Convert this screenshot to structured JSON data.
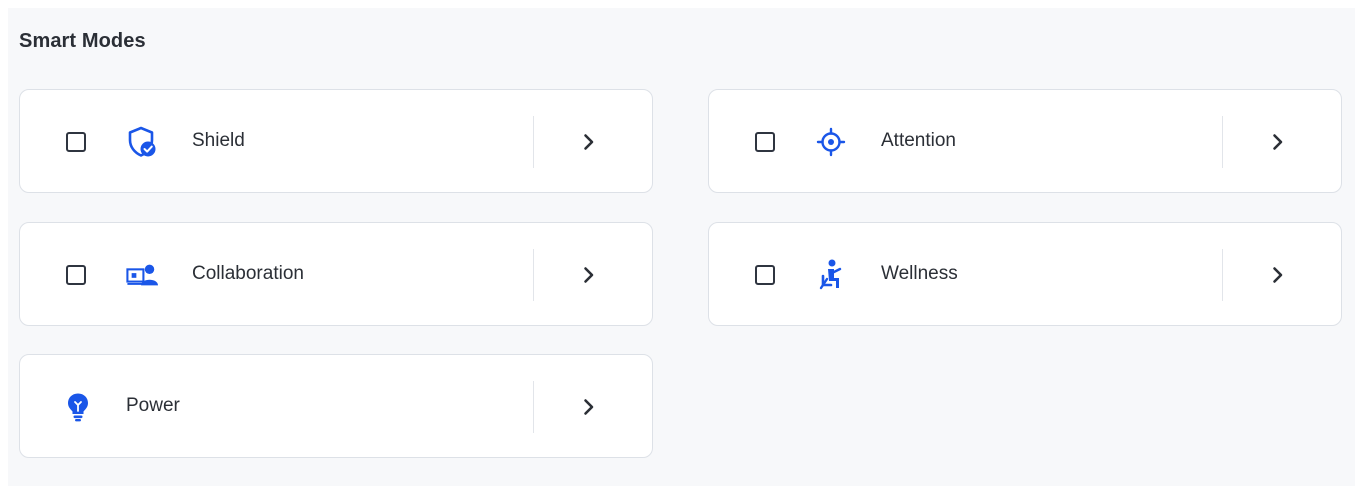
{
  "section": {
    "title": "Smart Modes"
  },
  "colors": {
    "accent": "#1a56e8",
    "text": "#2b2f36",
    "panel_bg": "#f7f8fa",
    "card_border": "#dde1e7"
  },
  "modes": [
    {
      "label": "Shield",
      "icon": "shield-check-icon",
      "checked": false,
      "has_checkbox": true
    },
    {
      "label": "Attention",
      "icon": "target-crosshair-icon",
      "checked": false,
      "has_checkbox": true
    },
    {
      "label": "Collaboration",
      "icon": "screen-person-icon",
      "checked": false,
      "has_checkbox": true
    },
    {
      "label": "Wellness",
      "icon": "seated-person-icon",
      "checked": false,
      "has_checkbox": true
    },
    {
      "label": "Power",
      "icon": "lightbulb-icon",
      "has_checkbox": false
    }
  ]
}
